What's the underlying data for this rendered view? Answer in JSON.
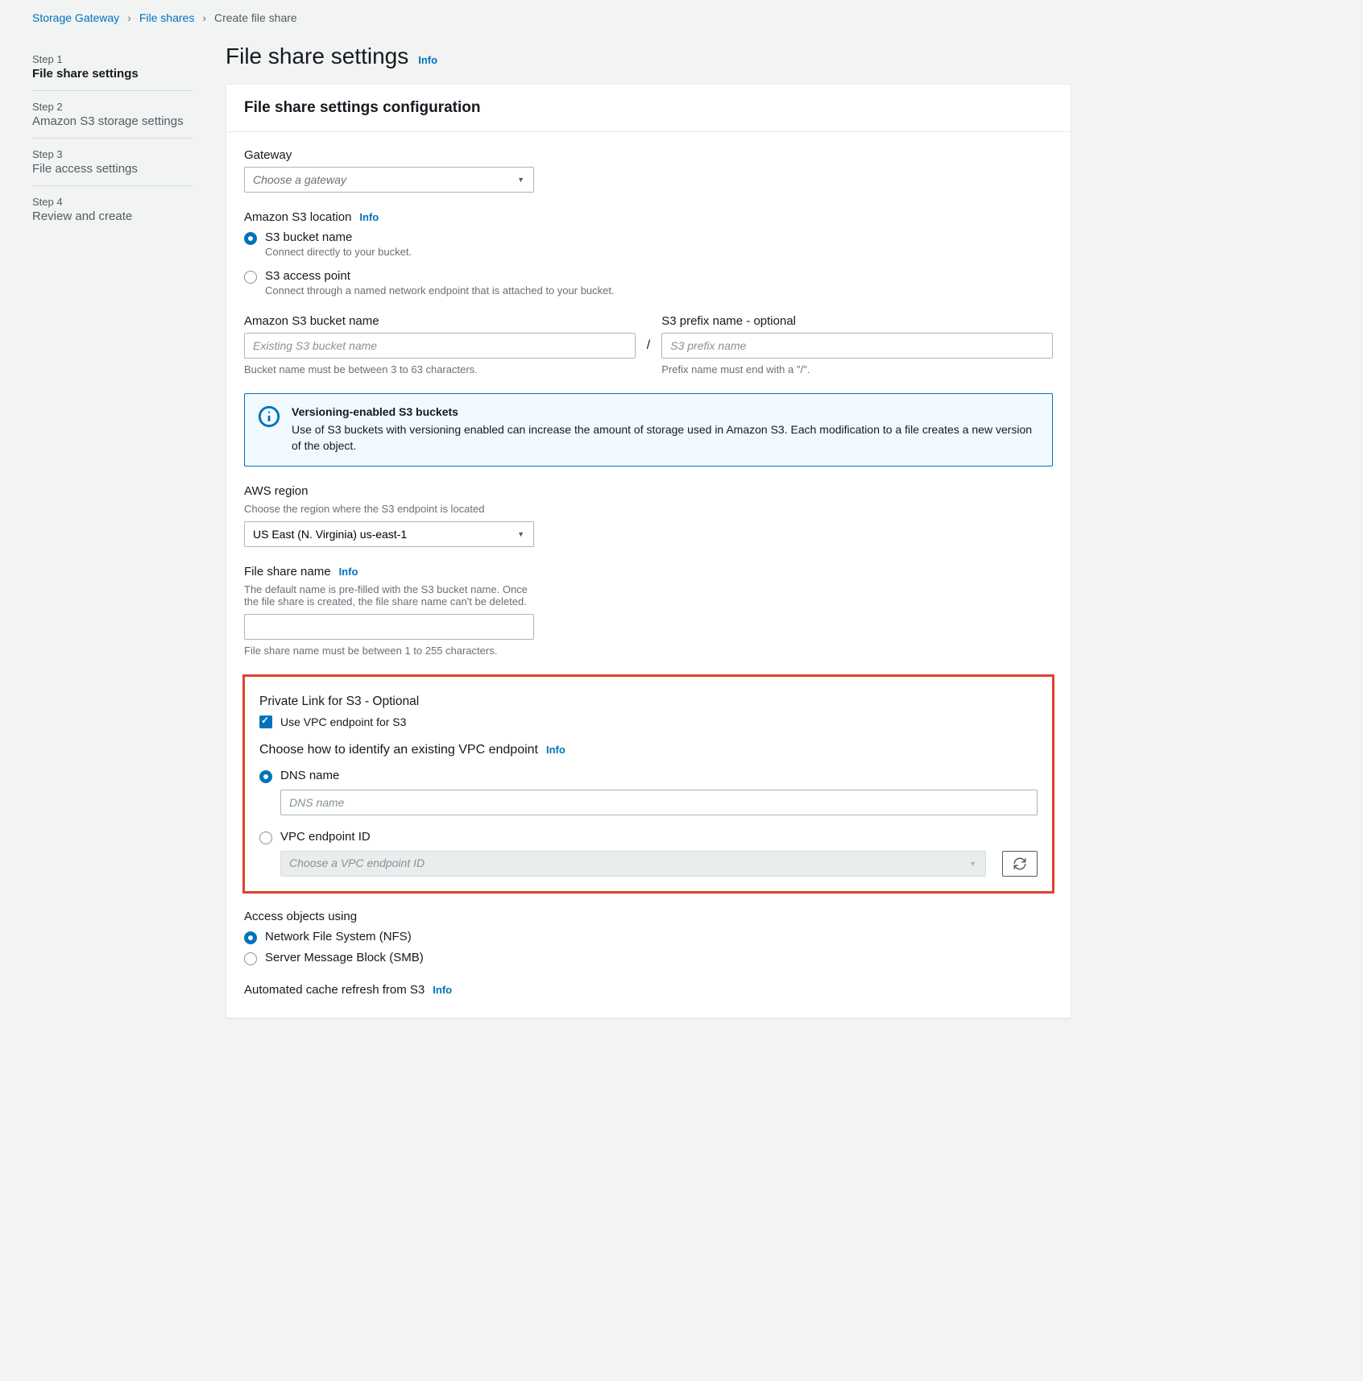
{
  "breadcrumb": {
    "items": [
      "Storage Gateway",
      "File shares"
    ],
    "current": "Create file share"
  },
  "steps": [
    {
      "num": "Step 1",
      "name": "File share settings",
      "active": true
    },
    {
      "num": "Step 2",
      "name": "Amazon S3 storage settings",
      "active": false
    },
    {
      "num": "Step 3",
      "name": "File access settings",
      "active": false
    },
    {
      "num": "Step 4",
      "name": "Review and create",
      "active": false
    }
  ],
  "page": {
    "title": "File share settings",
    "info": "Info"
  },
  "panel": {
    "heading": "File share settings configuration"
  },
  "gateway": {
    "label": "Gateway",
    "placeholder": "Choose a gateway"
  },
  "s3location": {
    "label": "Amazon S3 location",
    "info": "Info",
    "options": [
      {
        "label": "S3 bucket name",
        "desc": "Connect directly to your bucket.",
        "checked": true
      },
      {
        "label": "S3 access point",
        "desc": "Connect through a named network endpoint that is attached to your bucket.",
        "checked": false
      }
    ]
  },
  "bucket": {
    "label": "Amazon S3 bucket name",
    "placeholder": "Existing S3 bucket name",
    "hint": "Bucket name must be between 3 to 63 characters."
  },
  "prefix": {
    "label": "S3 prefix name - optional",
    "placeholder": "S3 prefix name",
    "hint": "Prefix name must end with a \"/\"."
  },
  "alert": {
    "title": "Versioning-enabled S3 buckets",
    "text": "Use of S3 buckets with versioning enabled can increase the amount of storage used in Amazon S3. Each modification to a file creates a new version of the object."
  },
  "region": {
    "label": "AWS region",
    "desc": "Choose the region where the S3 endpoint is located",
    "value": "US East (N. Virginia) us-east-1"
  },
  "sharename": {
    "label": "File share name",
    "info": "Info",
    "desc": "The default name is pre-filled with the S3 bucket name. Once the file share is created, the file share name can't be deleted.",
    "hint": "File share name must be between 1 to 255 characters."
  },
  "privatelink": {
    "heading": "Private Link for S3 - Optional",
    "checkbox_label": "Use VPC endpoint for S3",
    "identify_label": "Choose how to identify an existing VPC endpoint",
    "info": "Info",
    "options": {
      "dns": {
        "label": "DNS name",
        "placeholder": "DNS name",
        "checked": true
      },
      "vpcid": {
        "label": "VPC endpoint ID",
        "placeholder": "Choose a VPC endpoint ID",
        "checked": false
      }
    }
  },
  "access": {
    "label": "Access objects using",
    "options": [
      {
        "label": "Network File System (NFS)",
        "checked": true
      },
      {
        "label": "Server Message Block (SMB)",
        "checked": false
      }
    ]
  },
  "cacherefresh": {
    "label": "Automated cache refresh from S3",
    "info": "Info"
  }
}
